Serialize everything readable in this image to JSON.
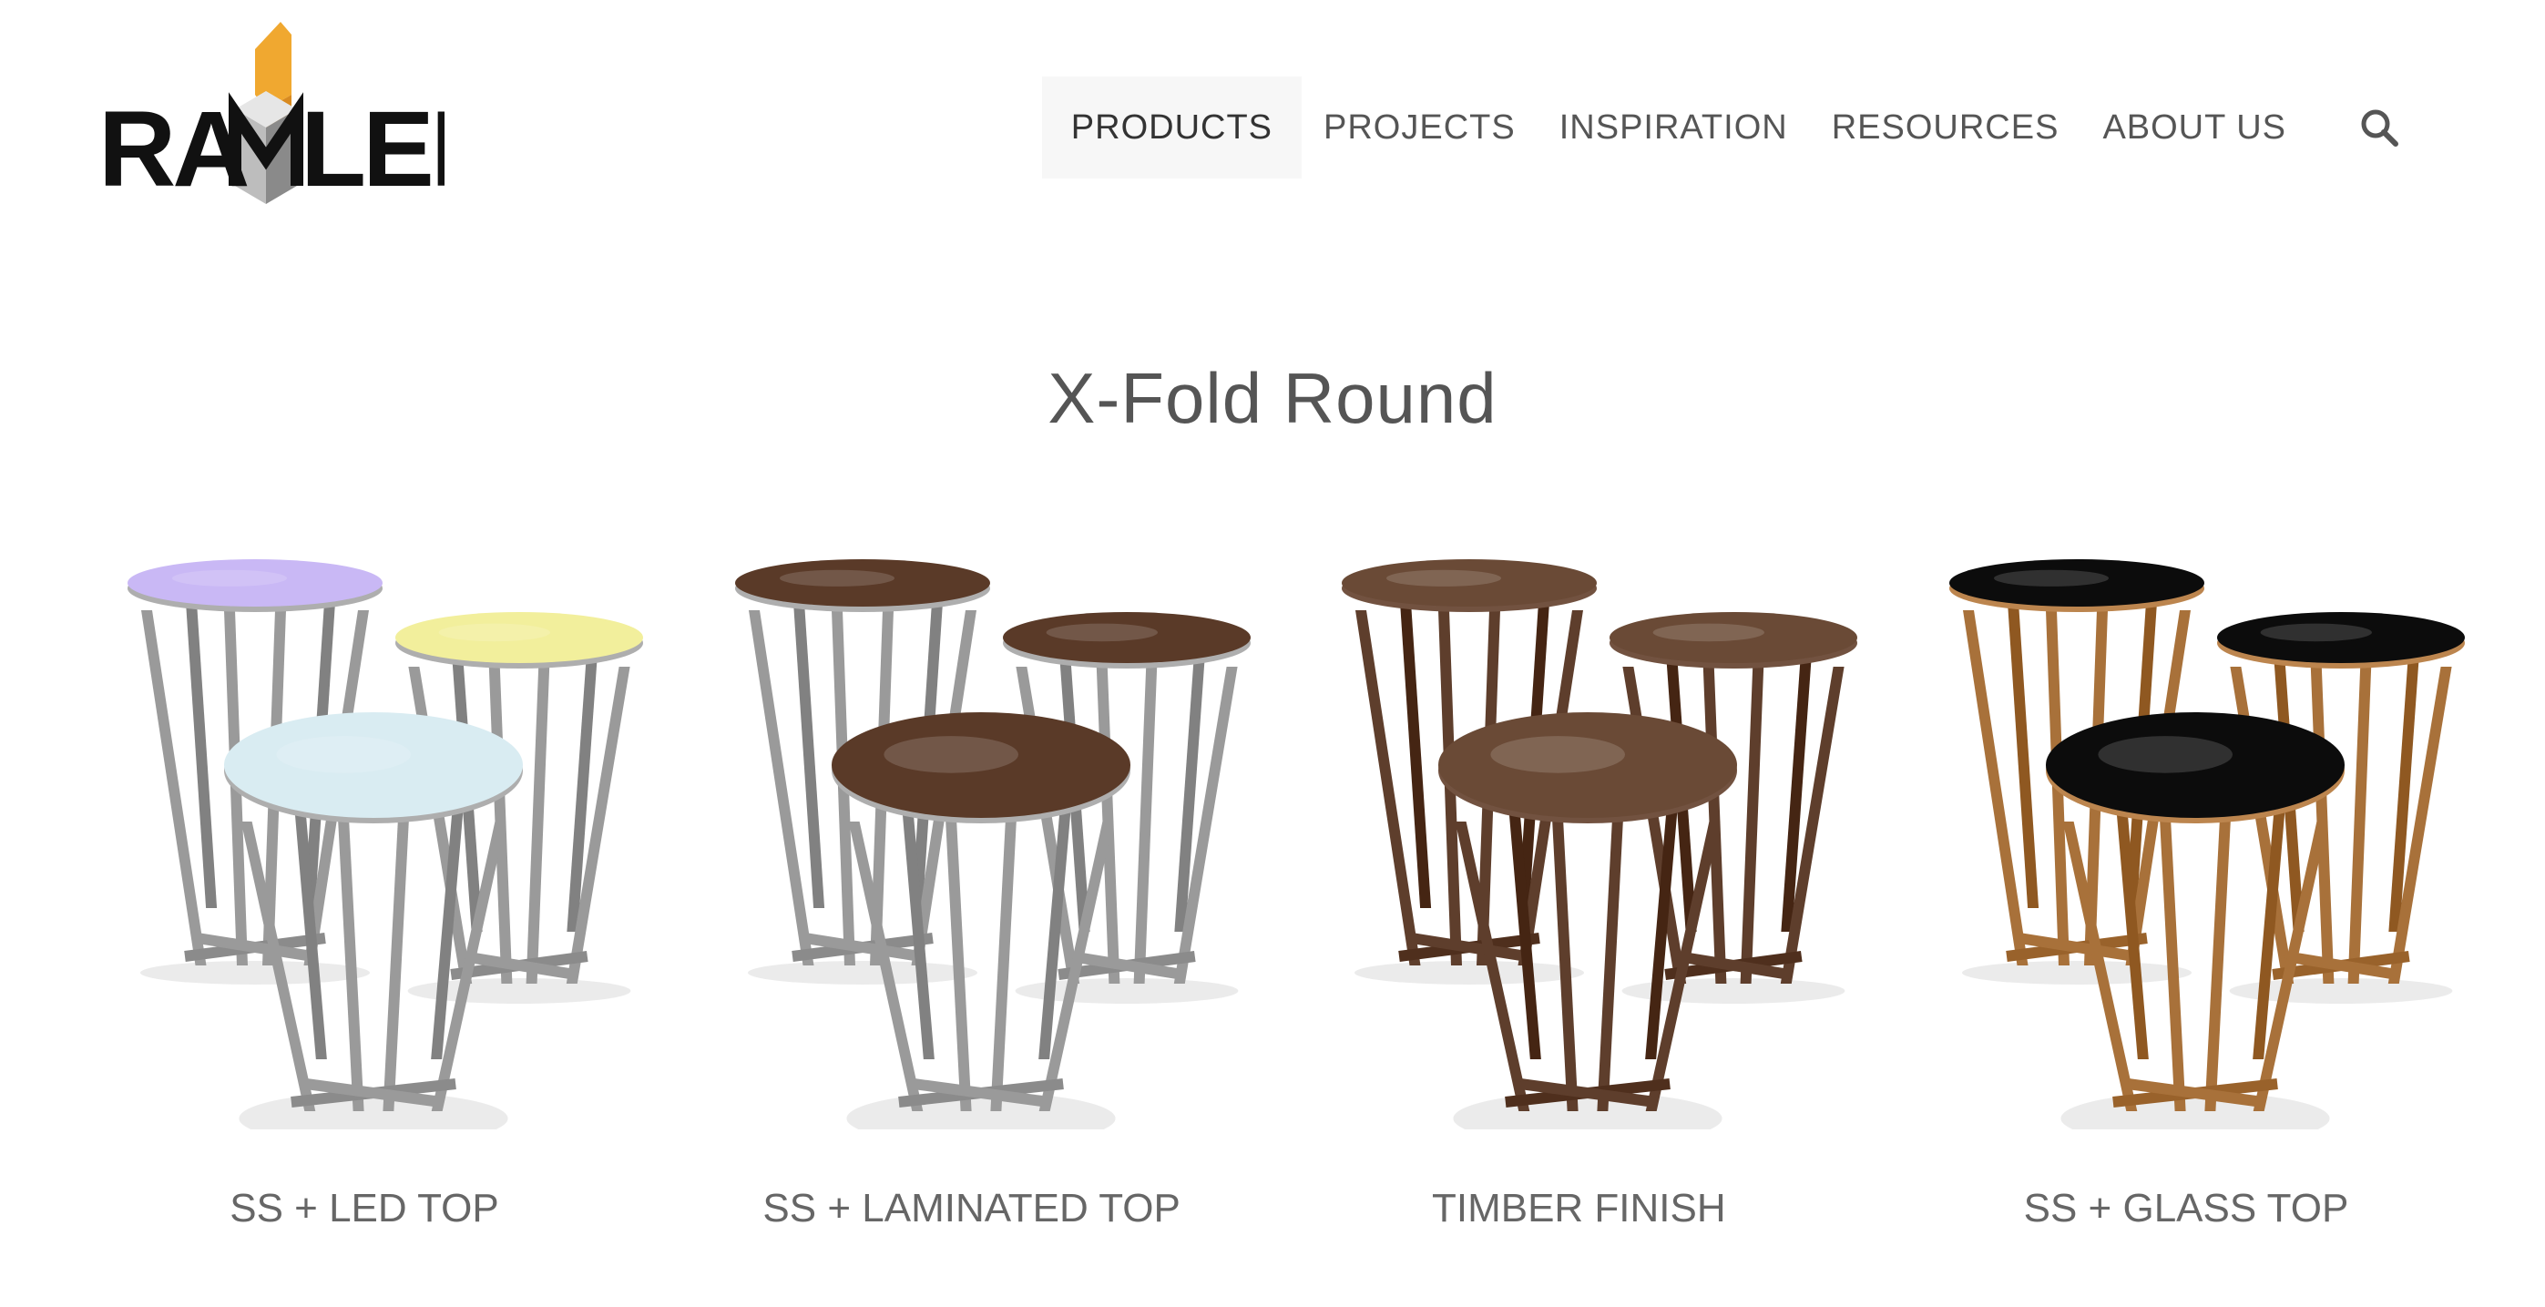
{
  "header": {
    "logo_text": "RAMLER",
    "nav": [
      {
        "label": "PRODUCTS",
        "active": true
      },
      {
        "label": "PROJECTS",
        "active": false
      },
      {
        "label": "INSPIRATION",
        "active": false
      },
      {
        "label": "RESOURCES",
        "active": false
      },
      {
        "label": "ABOUT US",
        "active": false
      }
    ],
    "search_icon": "search-icon"
  },
  "main": {
    "title": "X-Fold Round",
    "products": [
      {
        "label": "SS + LED TOP",
        "frame_color": "#9a9a9a",
        "top_colors": [
          "#c9b8f5",
          "#f2ef9c",
          "#d9ecf2"
        ]
      },
      {
        "label": "SS + LAMINATED TOP",
        "frame_color": "#9a9a9a",
        "top_colors": [
          "#5a3a28",
          "#5a3a28",
          "#5a3a28"
        ]
      },
      {
        "label": "TIMBER FINISH",
        "frame_color": "#5e3e2c",
        "top_colors": [
          "#6a4a36",
          "#6a4a36",
          "#6a4a36"
        ]
      },
      {
        "label": "SS + GLASS TOP",
        "frame_color": "#a8713a",
        "top_colors": [
          "#0c0c0c",
          "#0c0c0c",
          "#0c0c0c"
        ]
      }
    ]
  },
  "colors": {
    "text": "#555555",
    "nav_active_bg": "#f7f7f7",
    "logo_accent": "#f0a830"
  }
}
